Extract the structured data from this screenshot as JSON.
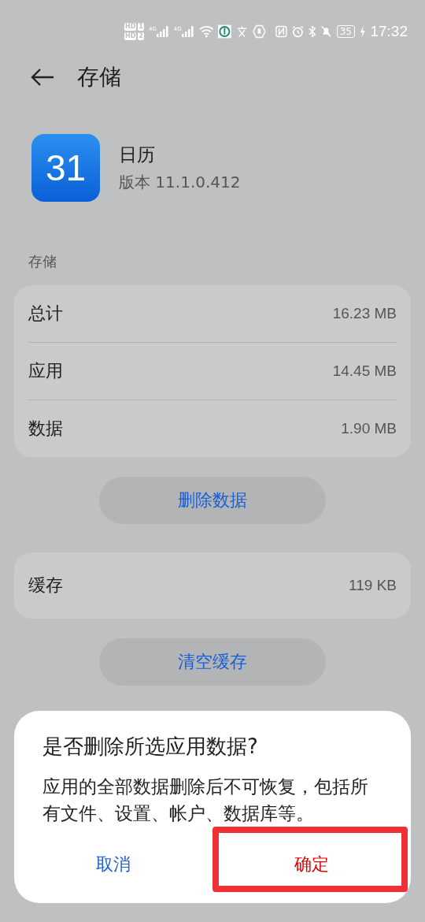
{
  "status_bar": {
    "sim": [
      {
        "hd": "HD",
        "slot": "1"
      },
      {
        "hd": "HD",
        "slot": "2"
      }
    ],
    "networks": [
      "4G",
      "4G"
    ],
    "battery": "35",
    "time": "17:32"
  },
  "header": {
    "title": "存储"
  },
  "app": {
    "icon_text": "31",
    "name": "日历",
    "version": "版本 11.1.0.412"
  },
  "storage": {
    "label": "存储",
    "rows": [
      {
        "name": "总计",
        "value": "16.23 MB"
      },
      {
        "name": "应用",
        "value": "14.45 MB"
      },
      {
        "name": "数据",
        "value": "1.90 MB"
      }
    ],
    "button": "删除数据"
  },
  "cache": {
    "rows": [
      {
        "name": "缓存",
        "value": "119 KB"
      }
    ],
    "button": "清空缓存"
  },
  "dialog": {
    "title": "是否删除所选应用数据?",
    "message": "应用的全部数据删除后不可恢复，包括所有文件、设置、帐户、数据库等。",
    "buttons": [
      {
        "label": "取消",
        "kind": "cancel",
        "highlighted": false
      },
      {
        "label": "确定",
        "kind": "confirm",
        "highlighted": true
      }
    ]
  }
}
